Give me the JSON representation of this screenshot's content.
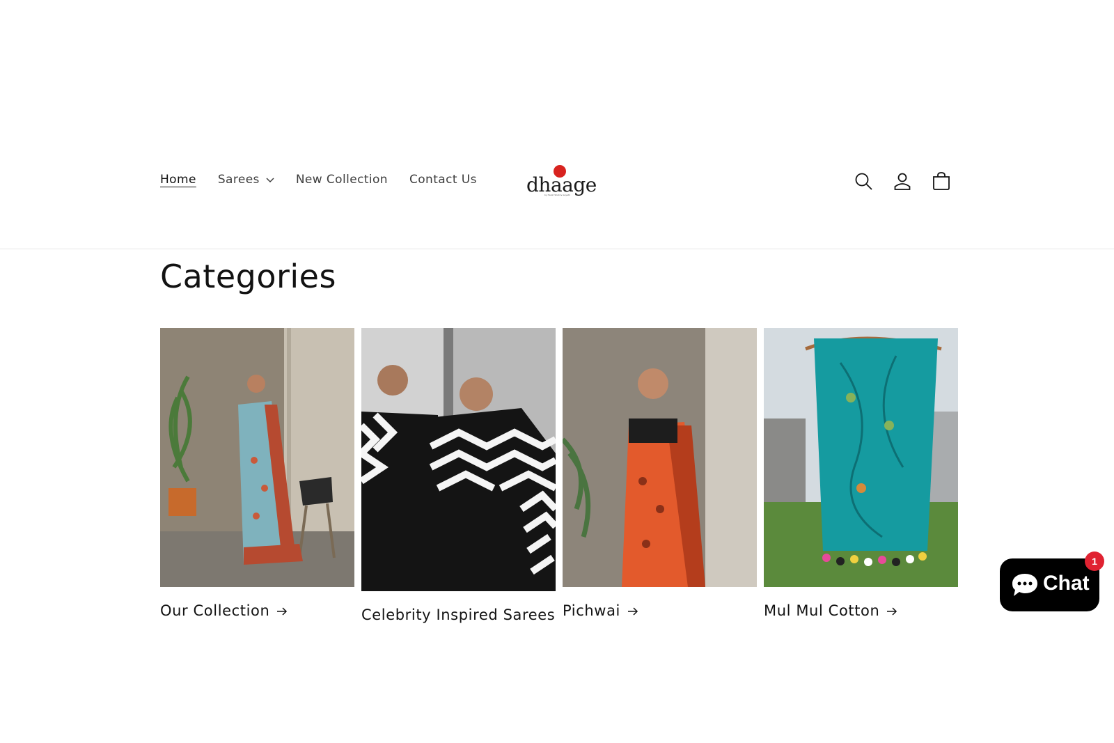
{
  "brand": {
    "logo_text": "dhaage",
    "logo_tagline": "by Harsh Shah & Gayatri"
  },
  "nav": {
    "items": [
      {
        "label": "Home",
        "active": true
      },
      {
        "label": "Sarees",
        "has_dropdown": true
      },
      {
        "label": "New Collection"
      },
      {
        "label": "Contact Us"
      }
    ]
  },
  "header_icons": [
    "search-icon",
    "account-icon",
    "cart-icon"
  ],
  "section": {
    "title": "Categories"
  },
  "categories": [
    {
      "label": "Our Collection",
      "image": "woman in blue and red printed saree seated on chair beside potted plant"
    },
    {
      "label": "Celebrity Inspired Sarees",
      "image": "woman in black and white chevron saree with reflection"
    },
    {
      "label": "Pichwai",
      "image": "woman in orange printed saree"
    },
    {
      "label": "Mul Mul Cotton",
      "image": "teal embroidered dupatta with tassels hanging outdoors"
    }
  ],
  "chat": {
    "label": "Chat",
    "badge_count": "1"
  },
  "colors": {
    "accent": "#d8231f",
    "text": "#121212",
    "chat_bg": "#000000",
    "badge": "#e02231"
  }
}
